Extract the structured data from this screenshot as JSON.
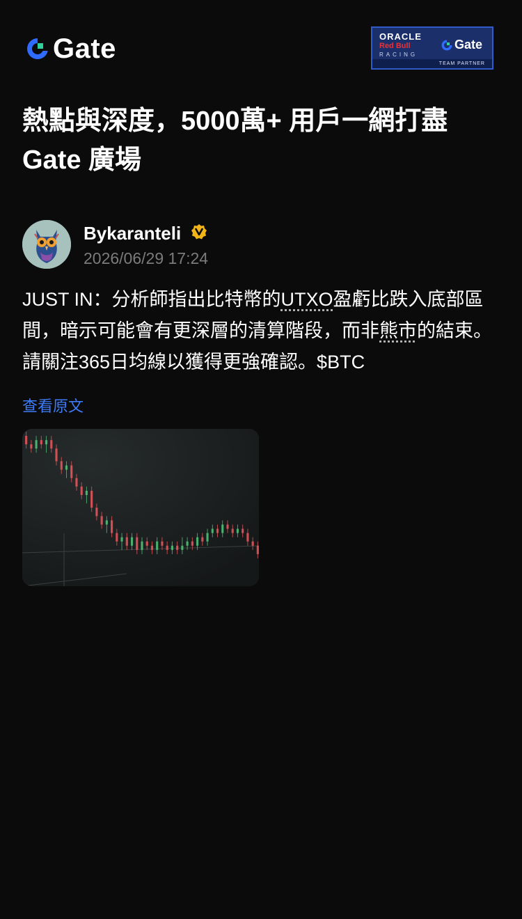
{
  "header": {
    "brand_name": "Gate",
    "partner": {
      "line1": "ORACLE",
      "line2": "Red Bull",
      "line3": "RACING",
      "brand": "Gate",
      "footer": "TEAM PARTNER"
    }
  },
  "headline": {
    "line1": "熱點與深度，5000萬+ 用戶一網打盡",
    "line2": "Gate 廣場"
  },
  "post": {
    "author_name": "Bykaranteli",
    "timestamp": "2026/06/29 17:24",
    "text_part1": "JUST IN：分析師指出比特幣的",
    "text_utxo": "UTXO",
    "text_part2": "盈虧比跌入底部區間，暗示可能會有更深層的清算階段，而非",
    "text_bear": "熊市",
    "text_part3": "的結束。請關注365日均線以獲得更強確認。$BTC",
    "view_original": "查看原文"
  },
  "colors": {
    "background": "#0b0b0b",
    "accent_blue": "#3d7bf7",
    "verified_badge": "#f2b416",
    "candle_up": "#4fbf77",
    "candle_down": "#e2555a"
  },
  "chart_data": {
    "type": "candlestick",
    "series": [
      {
        "values": [
          [
            101,
            99,
            102,
            98
          ],
          [
            99,
            98,
            100,
            97
          ],
          [
            98,
            100,
            101,
            97
          ],
          [
            100,
            99,
            101,
            98
          ],
          [
            99,
            100,
            101,
            97
          ],
          [
            100,
            98,
            101,
            97
          ],
          [
            98,
            95,
            99,
            94
          ],
          [
            95,
            93,
            96,
            92
          ],
          [
            93,
            94,
            95,
            91
          ],
          [
            94,
            91,
            95,
            90
          ],
          [
            91,
            89,
            92,
            88
          ],
          [
            89,
            87,
            90,
            86
          ],
          [
            87,
            88,
            89,
            85
          ],
          [
            88,
            84,
            89,
            83
          ],
          [
            84,
            82,
            85,
            81
          ],
          [
            82,
            80,
            83,
            79
          ],
          [
            80,
            81,
            82,
            78
          ],
          [
            81,
            78,
            82,
            77
          ],
          [
            78,
            76,
            79,
            75
          ],
          [
            76,
            77,
            78,
            74
          ],
          [
            77,
            75,
            78,
            74
          ],
          [
            75,
            77,
            78,
            74
          ],
          [
            77,
            74,
            78,
            73
          ],
          [
            74,
            76,
            77,
            73
          ],
          [
            76,
            75,
            77,
            74
          ],
          [
            75,
            74,
            76,
            73
          ],
          [
            74,
            76,
            77,
            73
          ],
          [
            76,
            75,
            77,
            74
          ],
          [
            75,
            74,
            76,
            73
          ],
          [
            74,
            75,
            76,
            73
          ],
          [
            75,
            74,
            76,
            73
          ],
          [
            74,
            75,
            77,
            73
          ],
          [
            75,
            76,
            77,
            74
          ],
          [
            76,
            75,
            77,
            74
          ],
          [
            75,
            77,
            78,
            74
          ],
          [
            77,
            76,
            78,
            75
          ],
          [
            76,
            78,
            79,
            75
          ],
          [
            78,
            79,
            80,
            77
          ],
          [
            79,
            78,
            80,
            77
          ],
          [
            78,
            80,
            81,
            77
          ],
          [
            80,
            79,
            81,
            78
          ],
          [
            79,
            78,
            80,
            77
          ],
          [
            78,
            79,
            80,
            77
          ],
          [
            79,
            78,
            80,
            77
          ],
          [
            78,
            76,
            79,
            75
          ],
          [
            76,
            75,
            77,
            74
          ],
          [
            75,
            73,
            76,
            72
          ]
        ]
      }
    ]
  }
}
